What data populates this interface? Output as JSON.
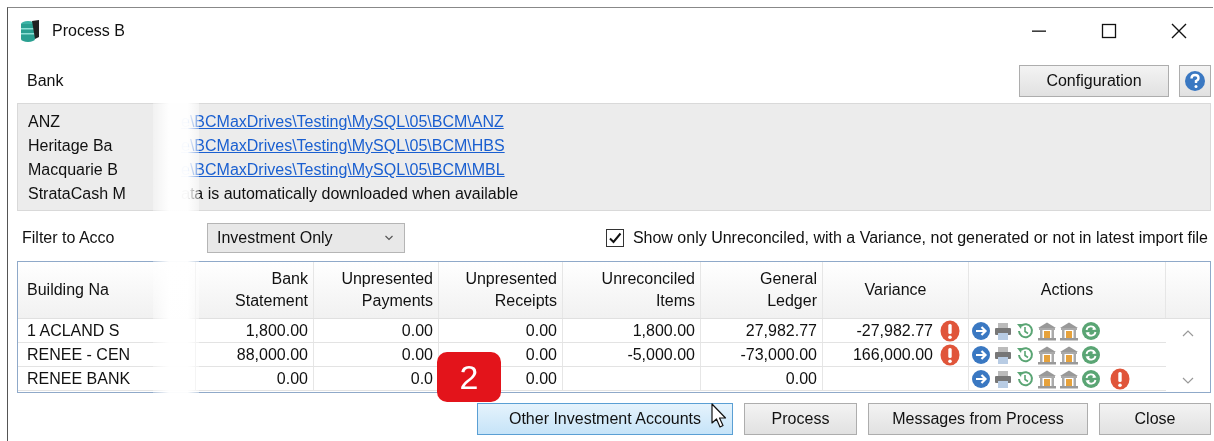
{
  "window": {
    "title": "Process B"
  },
  "configuration_button": "Configuration",
  "bank_list": {
    "label": "Bank",
    "rows": [
      {
        "bank": "ANZ",
        "location": "e\\BCMaxDrives\\Testing\\MySQL\\05\\BCM\\ANZ",
        "kind": "link"
      },
      {
        "bank": "Heritage Ba",
        "location": "e\\BCMaxDrives\\Testing\\MySQL\\05\\BCM\\HBS",
        "kind": "link"
      },
      {
        "bank": "Macquarie B",
        "location": "e\\BCMaxDrives\\Testing\\MySQL\\05\\BCM\\MBL",
        "kind": "link"
      },
      {
        "bank": "StrataCash M",
        "location": "ata is automatically downloaded when available",
        "kind": "text"
      }
    ]
  },
  "filter": {
    "label": "Filter to Acco",
    "dropdown": "Investment Only",
    "checkbox": {
      "label": "Show only Unreconciled, with a Variance, not generated or not in latest import file",
      "checked": true
    }
  },
  "table": {
    "columns": [
      "Building Na",
      "Bank\nStatement",
      "Unpresented\nPayments",
      "Unpresented\nReceipts",
      "Unreconciled\nItems",
      "General\nLedger",
      "Variance",
      "Actions"
    ],
    "rows": [
      {
        "cells": [
          "1 ACLAND S",
          "1,800.00",
          "0.00",
          "0.00",
          "1,800.00",
          "27,982.77",
          "-27,982.77"
        ],
        "variance_warning": true,
        "action_warning": false
      },
      {
        "cells": [
          "RENEE - CEN",
          "88,000.00",
          "0.00",
          "0.00",
          "-5,000.00",
          "-73,000.00",
          "166,000.00"
        ],
        "variance_warning": true,
        "action_warning": false
      },
      {
        "cells": [
          "RENEE BANK",
          "0.00",
          "0.0",
          "0.00",
          null,
          "0.00",
          null
        ],
        "variance_warning": false,
        "action_warning": true
      }
    ]
  },
  "buttons": [
    {
      "label": "Other Investment Accounts",
      "hovered": true
    },
    {
      "label": "Process",
      "hovered": false
    },
    {
      "label": "Messages from Process",
      "hovered": false
    },
    {
      "label": "Close",
      "hovered": false
    }
  ],
  "badge": {
    "text": "2"
  }
}
